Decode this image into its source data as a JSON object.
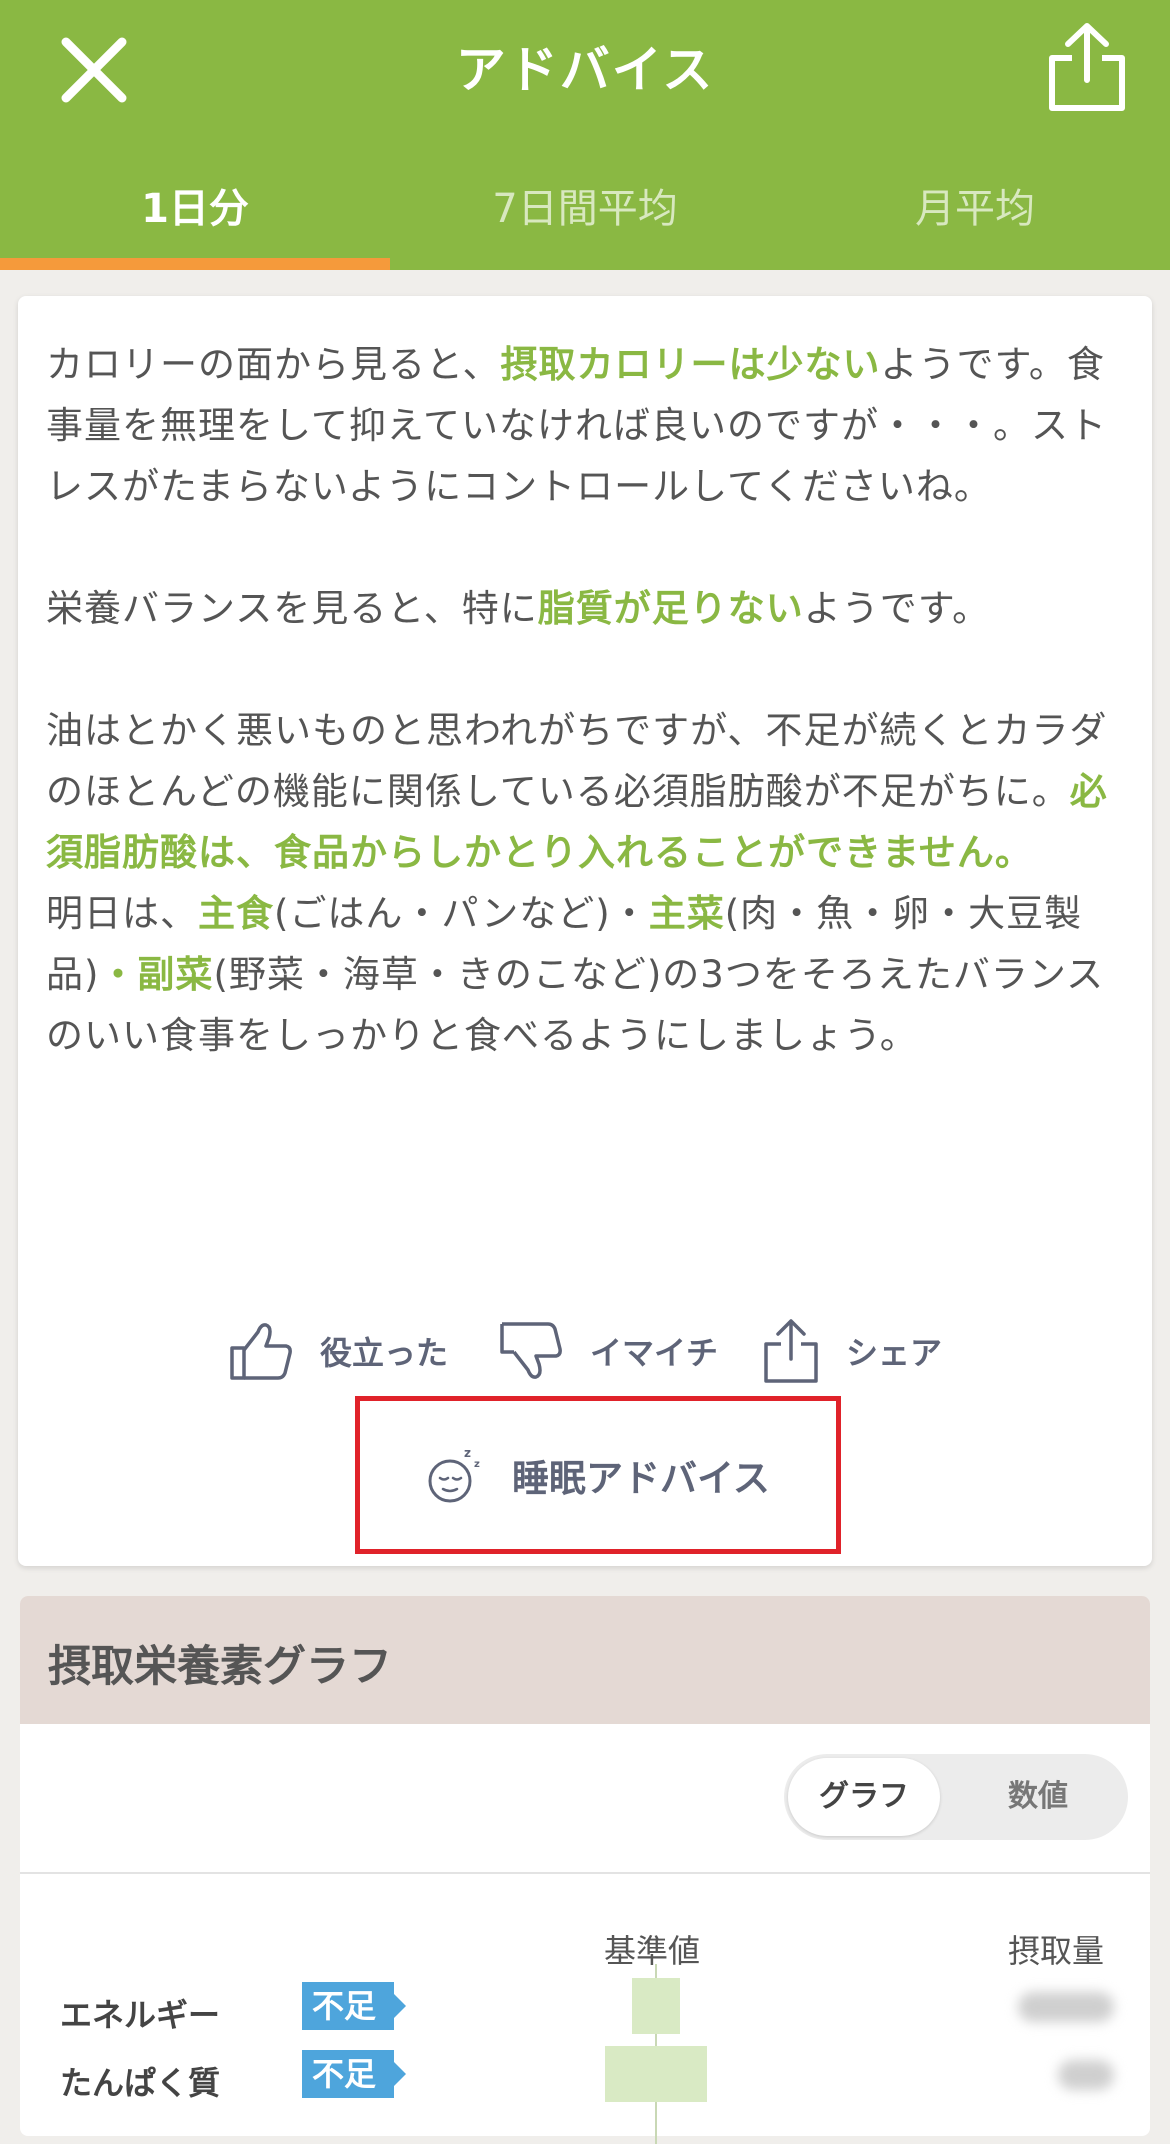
{
  "header": {
    "title": "アドバイス",
    "tabs": [
      {
        "label": "1日分",
        "active": true
      },
      {
        "label": "7日間平均",
        "active": false
      },
      {
        "label": "月平均",
        "active": false
      }
    ],
    "icons": [
      "close-icon",
      "share-icon"
    ]
  },
  "advice": {
    "p1_a": "カロリーの面から見ると、",
    "p1_hl": "摂取カロリーは少ない",
    "p1_b": "ようです。食事量を無理をして抑えていなければ良いのですが・・・。ストレスがたまらないようにコントロールしてくださいね。",
    "p2_a": "栄養バランスを見ると、特に",
    "p2_hl": "脂質が足りない",
    "p2_b": "ようです。",
    "p3_a": "油はとかく悪いものと思われがちですが、不足が続くとカラダのほとんどの機能に関係している必須脂肪酸が不足がちに。",
    "p3_hl": "必須脂肪酸は、食品からしかとり入れることができません。",
    "p4_a": "明日は、",
    "p4_hl1": "主食",
    "p4_b": "(ごはん・パンなど)・",
    "p4_hl2": "主菜",
    "p4_c": "(肉・魚・卵・大豆製品)",
    "p4_hl3": "・副菜",
    "p4_d": "(野菜・海草・きのこなど)の3つをそろえたバランスのいい食事をしっかりと食べるようにしましょう。"
  },
  "actions": {
    "useful": "役立った",
    "meh": "イマイチ",
    "share": "シェア",
    "sleep": "睡眠アドバイス"
  },
  "graph": {
    "title": "摂取栄養素グラフ",
    "toggle_on": "グラフ",
    "toggle_off": "数値",
    "col_standard": "基準値",
    "col_intake": "摂取量",
    "rows": [
      {
        "label": "エネルギー",
        "badge": "不足",
        "value": 0.35
      },
      {
        "label": "たんぱく質",
        "badge": "不足",
        "value": 0.75
      }
    ]
  },
  "colors": {
    "header": "#8ab843",
    "tab_indicator": "#f59a3b",
    "highlight": "#8ab843",
    "badge": "#4ea5dc",
    "focus_box": "#e0222a"
  }
}
